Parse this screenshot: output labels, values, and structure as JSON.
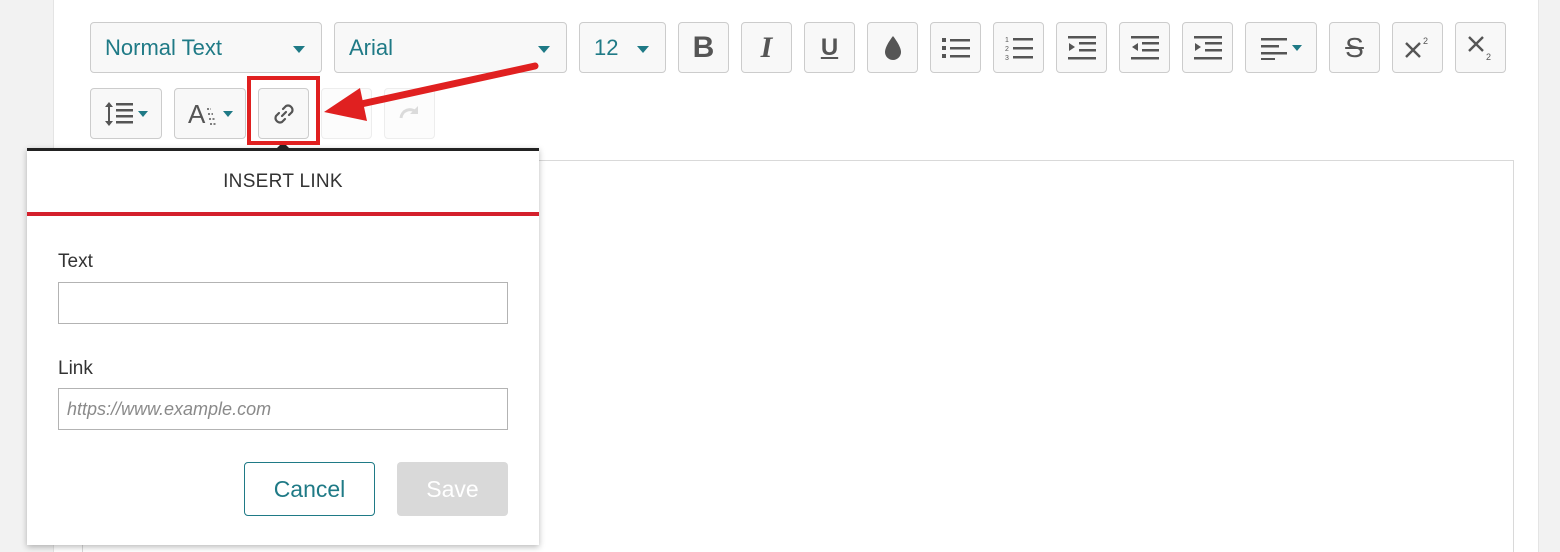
{
  "toolbar": {
    "paragraph_style": "Normal Text",
    "font_family": "Arial",
    "font_size": "12",
    "buttons": [
      {
        "name": "bold-button",
        "icon": "bold-icon"
      },
      {
        "name": "italic-button",
        "icon": "italic-icon"
      },
      {
        "name": "underline-button",
        "icon": "underline-icon"
      },
      {
        "name": "text-color-button",
        "icon": "ink-drop-icon"
      },
      {
        "name": "bulleted-list-button",
        "icon": "bulleted-list-icon"
      },
      {
        "name": "numbered-list-button",
        "icon": "numbered-list-icon"
      },
      {
        "name": "increase-indent-button",
        "icon": "indent-icon"
      },
      {
        "name": "decrease-indent-button",
        "icon": "outdent-icon"
      },
      {
        "name": "block-indent-button",
        "icon": "indent-icon"
      },
      {
        "name": "align-button",
        "icon": "align-left-icon"
      },
      {
        "name": "strikethrough-button",
        "icon": "strikethrough-icon"
      },
      {
        "name": "superscript-button",
        "icon": "superscript-icon"
      },
      {
        "name": "subscript-button",
        "icon": "subscript-icon"
      },
      {
        "name": "line-height-button",
        "icon": "line-height-icon"
      },
      {
        "name": "clear-format-button",
        "icon": "clear-format-icon"
      },
      {
        "name": "insert-link-button",
        "icon": "link-icon"
      },
      {
        "name": "undo-button",
        "icon": "undo-icon"
      },
      {
        "name": "redo-button",
        "icon": "redo-icon"
      }
    ],
    "accent_color": "#1f7a86"
  },
  "annotation": {
    "highlight_color": "#e02020"
  },
  "insert_link": {
    "title": "INSERT LINK",
    "text_label": "Text",
    "text_value": "",
    "link_label": "Link",
    "link_value": "",
    "link_placeholder": "https://www.example.com",
    "cancel_label": "Cancel",
    "save_label": "Save",
    "title_underline_color": "#d4202c",
    "save_enabled": false
  }
}
